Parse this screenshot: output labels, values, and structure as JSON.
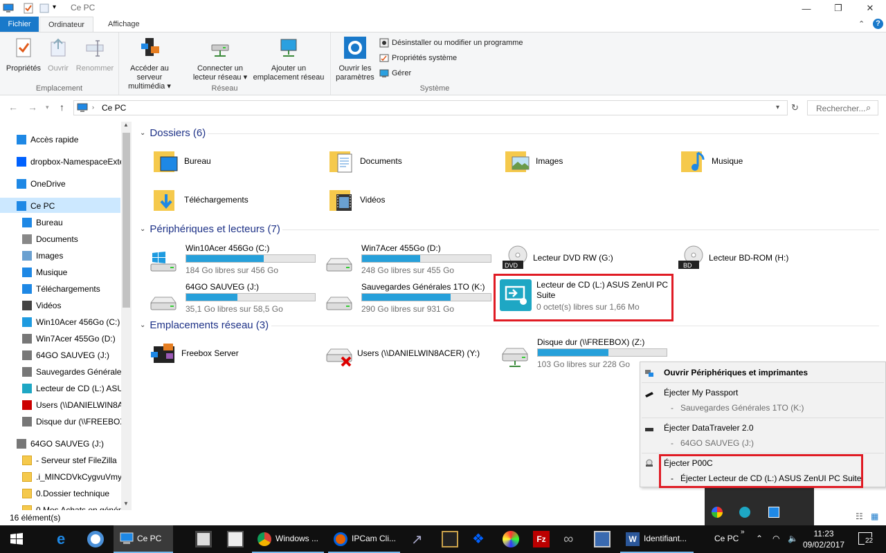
{
  "window": {
    "title": "Ce PC"
  },
  "tabs": [
    {
      "label": "Fichier"
    },
    {
      "label": "Ordinateur"
    },
    {
      "label": "Affichage"
    }
  ],
  "ribbon": {
    "emplacement": {
      "label": "Emplacement",
      "buttons": [
        {
          "label": "Propriétés",
          "icon": "checklist-icon"
        },
        {
          "label": "Ouvrir",
          "icon": "open-icon"
        },
        {
          "label": "Renommer",
          "icon": "rename-icon"
        }
      ]
    },
    "reseau": {
      "label": "Réseau",
      "buttons": [
        {
          "label1": "Accéder au serveur",
          "label2": "multimédia ▾",
          "icon": "media-server-icon"
        },
        {
          "label1": "Connecter un",
          "label2": "lecteur réseau ▾",
          "icon": "map-drive-icon"
        },
        {
          "label1": "Ajouter un",
          "label2": "emplacement réseau",
          "icon": "add-network-location-icon"
        }
      ]
    },
    "systeme": {
      "label": "Système",
      "open_settings_1": "Ouvrir les",
      "open_settings_2": "paramètres",
      "small": [
        {
          "label": "Désinstaller ou modifier un programme"
        },
        {
          "label": "Propriétés système"
        },
        {
          "label": "Gérer"
        }
      ]
    }
  },
  "address": {
    "path": "Ce PC",
    "search_placeholder": "Rechercher..."
  },
  "nav": {
    "items": [
      {
        "label": "Accès rapide",
        "icon": "star-icon"
      },
      {
        "label": "dropbox-NamespaceExte",
        "icon": "dropbox-icon"
      },
      {
        "label": "OneDrive",
        "icon": "cloud-icon"
      },
      {
        "label": "Ce PC",
        "icon": "computer-icon"
      },
      {
        "label": "Bureau",
        "icon": "desktop-icon"
      },
      {
        "label": "Documents",
        "icon": "document-icon"
      },
      {
        "label": "Images",
        "icon": "image-icon"
      },
      {
        "label": "Musique",
        "icon": "music-icon"
      },
      {
        "label": "Téléchargements",
        "icon": "download-icon"
      },
      {
        "label": "Vidéos",
        "icon": "video-icon"
      },
      {
        "label": "Win10Acer 456Go (C:)",
        "icon": "windows-drive-icon"
      },
      {
        "label": "Win7Acer 455Go (D:)",
        "icon": "drive-icon"
      },
      {
        "label": "64GO SAUVEG (J:)",
        "icon": "drive-icon"
      },
      {
        "label": "Sauvegardes Générales",
        "icon": "drive-icon"
      },
      {
        "label": "Lecteur de CD (L:) ASUS",
        "icon": "asus-cd-icon"
      },
      {
        "label": "Users (\\\\DANIELWIN8A",
        "icon": "network-drive-disconnected-icon"
      },
      {
        "label": "Disque dur (\\\\FREEBOX",
        "icon": "network-drive-icon"
      },
      {
        "label": "64GO SAUVEG (J:)",
        "icon": "drive-icon"
      },
      {
        "label": "- Serveur stef FileZilla",
        "icon": "folder-icon"
      },
      {
        "label": ".i_MINCDVkCygvuVmy",
        "icon": "folder-icon"
      },
      {
        "label": "0.Dossier technique",
        "icon": "folder-icon"
      },
      {
        "label": "0.Mes Achats en génér",
        "icon": "folder-icon"
      }
    ]
  },
  "content": {
    "folders_header": "Dossiers (6)",
    "folders": [
      {
        "label": "Bureau"
      },
      {
        "label": "Documents"
      },
      {
        "label": "Images"
      },
      {
        "label": "Musique"
      },
      {
        "label": "Téléchargements"
      },
      {
        "label": "Vidéos"
      }
    ],
    "devices_header": "Périphériques et lecteurs (7)",
    "drives": [
      {
        "name": "Win10Acer 456Go (C:)",
        "free": "184 Go libres sur 456 Go",
        "used_fraction": 0.6
      },
      {
        "name": "Win7Acer 455Go (D:)",
        "free": "248 Go libres sur 455 Go",
        "used_fraction": 0.45
      },
      {
        "name": "Lecteur DVD RW (G:)",
        "free": ""
      },
      {
        "name": "Lecteur BD-ROM (H:)",
        "free": ""
      },
      {
        "name": "64GO SAUVEG (J:)",
        "free": "35,1 Go libres sur 58,5 Go",
        "used_fraction": 0.4
      },
      {
        "name": "Sauvegardes Générales 1TO (K:)",
        "free": "290 Go libres sur 931 Go",
        "used_fraction": 0.69
      },
      {
        "name1": "Lecteur de CD (L:) ASUS ZenUI PC",
        "name2": "Suite",
        "free": "0 octet(s) libres sur 1,66 Mo"
      }
    ],
    "network_header": "Emplacements réseau (3)",
    "network": [
      {
        "name": "Freebox Server"
      },
      {
        "name": "Users (\\\\DANIELWIN8ACER) (Y:)"
      },
      {
        "name": "Disque dur (\\\\FREEBOX) (Z:)",
        "free": "103 Go libres sur 228 Go",
        "used_fraction": 0.55
      }
    ]
  },
  "status": {
    "count": "16 élément(s)"
  },
  "context_menu": {
    "header": "Ouvrir Périphériques et imprimantes",
    "groups": [
      {
        "title": "Éjecter My Passport",
        "sub": "Sauvegardes Générales 1TO (K:)"
      },
      {
        "title": "Éjecter DataTraveler 2.0",
        "sub": "64GO SAUVEG (J:)"
      },
      {
        "title": "Éjecter P00C",
        "sub": "Éjecter Lecteur de CD (L:) ASUS ZenUI PC Suite"
      }
    ]
  },
  "taskbar": {
    "items": [
      {
        "label": "Ce PC"
      },
      {
        "label": "Windows ..."
      },
      {
        "label": "IPCam Cli..."
      },
      {
        "label": "Identifiant..."
      }
    ],
    "tray_label": "Ce PC",
    "time": "11:23",
    "date": "09/02/2017",
    "notifications": "22"
  },
  "colors": {
    "accent": "#1979ca",
    "bar": "#26a0da",
    "highlight": "#e01b24",
    "selected": "#cce8ff"
  }
}
